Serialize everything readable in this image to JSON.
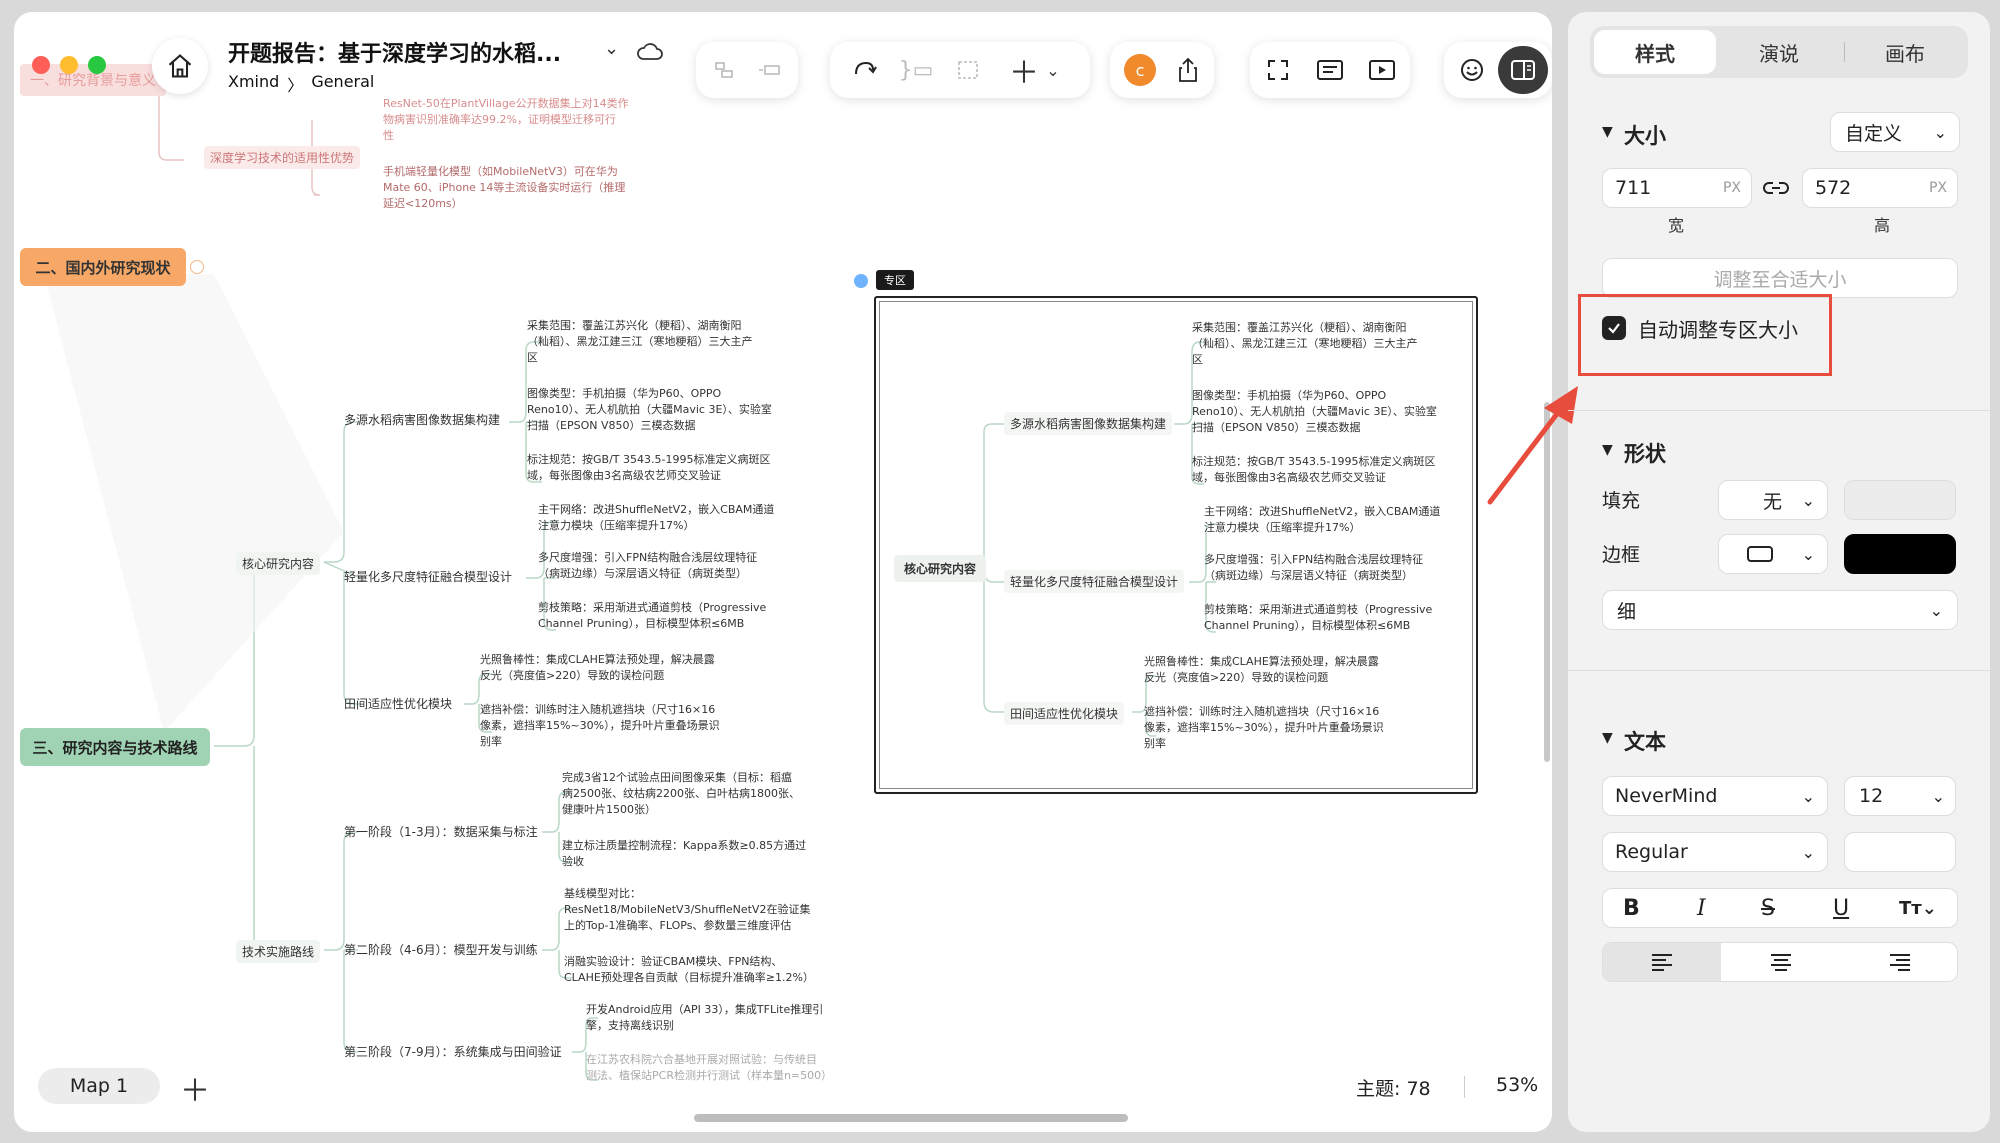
{
  "window": {
    "doc_title": "开题报告：基于深度学习的水稻...",
    "breadcrumb_root": "Xmind",
    "breadcrumb_sep": "〉",
    "breadcrumb_leaf": "General",
    "avatar_letter": "c"
  },
  "mindmap": {
    "top_faded_1": "一、研究背景与意义",
    "top_branch_1": "深度学习技术的适用性优势",
    "top_leaf_1": "ResNet-50在PlantVillage公开数据集上对14类作\n物病害识别准确率达99.2%，证明模型迁移可行\n性",
    "top_leaf_2": "手机端轻量化模型（如MobileNetV3）可在华为\nMate 60、iPhone 14等主流设备实时运行（推理\n延迟<120ms）",
    "root_2": "二、国内外研究现状",
    "root_3": "三、研究内容与技术路线",
    "core": "核心研究内容",
    "b1": "多源水稻病害图像数据集构建",
    "b1_l1": "采集范围：覆盖江苏兴化（粳稻）、湖南衡阳\n（籼稻）、黑龙江建三江（寒地粳稻）三大主产\n区",
    "b1_l2": "图像类型：手机拍摄（华为P60、OPPO\nReno10）、无人机航拍（大疆Mavic 3E）、实验室\n扫描（EPSON V850）三模态数据",
    "b1_l3": "标注规范：按GB/T 3543.5-1995标准定义病斑区\n域，每张图像由3名高级农艺师交叉验证",
    "b2": "轻量化多尺度特征融合模型设计",
    "b2_l1": "主干网络：改进ShuffleNetV2，嵌入CBAM通道\n注意力模块（压缩率提升17%）",
    "b2_l2": "多尺度增强：引入FPN结构融合浅层纹理特征\n（病斑边缘）与深层语义特征（病斑类型）",
    "b2_l3": "剪枝策略：采用渐进式通道剪枝（Progressive\nChannel Pruning），目标模型体积≤6MB",
    "b3": "田间适应性优化模块",
    "b3_l1": "光照鲁棒性：集成CLAHE算法预处理，解决晨露\n反光（亮度值>220）导致的误检问题",
    "b3_l2": "遮挡补偿：训练时注入随机遮挡块（尺寸16×16\n像素，遮挡率15%~30%），提升叶片重叠场景识\n别率",
    "tech": "技术实施路线",
    "p1": "第一阶段（1-3月）：数据采集与标注",
    "p1_l1": "完成3省12个试验点田间图像采集（目标：稻瘟\n病2500张、纹枯病2200张、白叶枯病1800张、\n健康叶片1500张）",
    "p1_l2": "建立标注质量控制流程：Kappa系数≥0.85方通过\n验收",
    "p2": "第二阶段（4-6月）：模型开发与训练",
    "p2_l1": "基线模型对比：\nResNet18/MobileNetV3/ShuffleNetV2在验证集\n上的Top-1准确率、FLOPs、参数量三维度评估",
    "p2_l2": "消融实验设计：验证CBAM模块、FPN结构、\nCLAHE预处理各自贡献（目标提升准确率≥1.2%）",
    "p3": "第三阶段（7-9月）：系统集成与田间验证",
    "p3_l1": "开发Android应用（API 33），集成TFLite推理引\n擎，支持离线识别",
    "p3_l2": "在江苏农科院六合基地开展对照试验：与传统目\n测法、植保站PCR检测并行测试（样本量n=500）",
    "zone_tag": "专区"
  },
  "bottom": {
    "map_tab": "Map 1",
    "topic_count": "主题: 78",
    "zoom": "53%"
  },
  "panel": {
    "tabs": [
      "样式",
      "演说",
      "画布"
    ],
    "size_title": "大小",
    "size_mode": "自定义",
    "width_value": "711",
    "height_value": "572",
    "unit": "PX",
    "width_label": "宽",
    "height_label": "高",
    "fit_button": "调整至合适大小",
    "auto_resize_label": "自动调整专区大小",
    "shape_title": "形状",
    "fill_label": "填充",
    "fill_value": "无",
    "border_label": "边框",
    "border_color": "#000000",
    "border_weight": "细",
    "text_title": "文本",
    "font_name": "NeverMind",
    "font_size": "12",
    "font_weight": "Regular",
    "highlight_color": "#e74c3c"
  }
}
